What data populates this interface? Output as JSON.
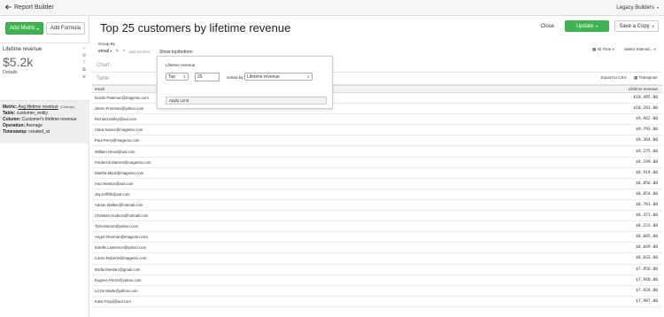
{
  "topbar": {
    "back_label": "Report Builder",
    "account": "Legacy Builders"
  },
  "left": {
    "add_metric": "Add Metric",
    "add_formula": "Add Formula",
    "metric_card": {
      "name": "Lifetime revenue",
      "value": "$5.2k",
      "details": "Details"
    },
    "metric_info": {
      "metric_label": "Metric:",
      "metric_value": "Avg lifetime revenue",
      "change": "(Change)",
      "table_label": "Table:",
      "table_value": "customer_entity",
      "column_label": "Column:",
      "column_value": "Customer's lifetime revenue",
      "operation_label": "Operation:",
      "operation_value": "Average",
      "timestamp_label": "Timestamp:",
      "timestamp_value": "created_at"
    }
  },
  "header": {
    "title": "Top 25 customers by lifetime revenue",
    "close": "Close",
    "update": "Update",
    "save": "Save a Copy"
  },
  "toolbar": {
    "group_by_label": "Group By",
    "group_by_value": "email",
    "add_another": "add another",
    "show_topbottom": "Show top/bottom",
    "all_time": "All Time",
    "select_interval": "Select Interval..."
  },
  "sections": {
    "chart": "Chart",
    "table": "Table",
    "export": "Export to CSV",
    "transpose": "Transpose"
  },
  "table": {
    "headers": [
      "email",
      "Lifetime revenue"
    ],
    "rows": [
      [
        "Dustin.Paterson@magento.com",
        "$10,495.00"
      ],
      [
        "Glenn.Freeman@yahoo.com",
        "$10,281.00"
      ],
      [
        "Richard.Kelley@aol.com",
        "$9,942.00"
      ],
      [
        "Clara.Nunez@magento.com",
        "$9,793.00"
      ],
      [
        "Paul.Perry@magento.com",
        "$9,364.00"
      ],
      [
        "William.Hines@aol.com",
        "$9,275.00"
      ],
      [
        "Frederick.Warren@magento.com",
        "$9,199.00"
      ],
      [
        "Martha.Mack@magento.com",
        "$8,919.00"
      ],
      [
        "Inez.Newton@aol.com",
        "$8,856.00"
      ],
      [
        "Jay.Griffith@aol.com",
        "$8,854.00"
      ],
      [
        "Adrian.Walker@hotmail.com",
        "$8,781.00"
      ],
      [
        "Christian.Hudson@hotmail.com",
        "$8,471.00"
      ],
      [
        "Tyler.Morton@yahoo.com",
        "$8,223.00"
      ],
      [
        "Angel.Sherman@magento.com",
        "$8,085.00"
      ],
      [
        "Estelle.Lawrence@yahoo.com",
        "$8,049.00"
      ],
      [
        "Carrie.Roberts@magento.com",
        "$8,032.00"
      ],
      [
        "Birdie.Mendez@gmail.com",
        "$7,956.00"
      ],
      [
        "Eugene.Perez@yahoo.com",
        "$7,940.00"
      ],
      [
        "Lizzie.Wade@yahoo.com",
        "$7,928.00"
      ],
      [
        "Katie.Floyd@aol.com",
        "$7,907.00"
      ]
    ]
  },
  "popup": {
    "title": "Lifetime revenue",
    "direction": "Top",
    "count": "25",
    "sorted_by_label": "sorted by:",
    "sorted_by_value": "Lifetime revenue",
    "apply": "Apply Limit"
  }
}
